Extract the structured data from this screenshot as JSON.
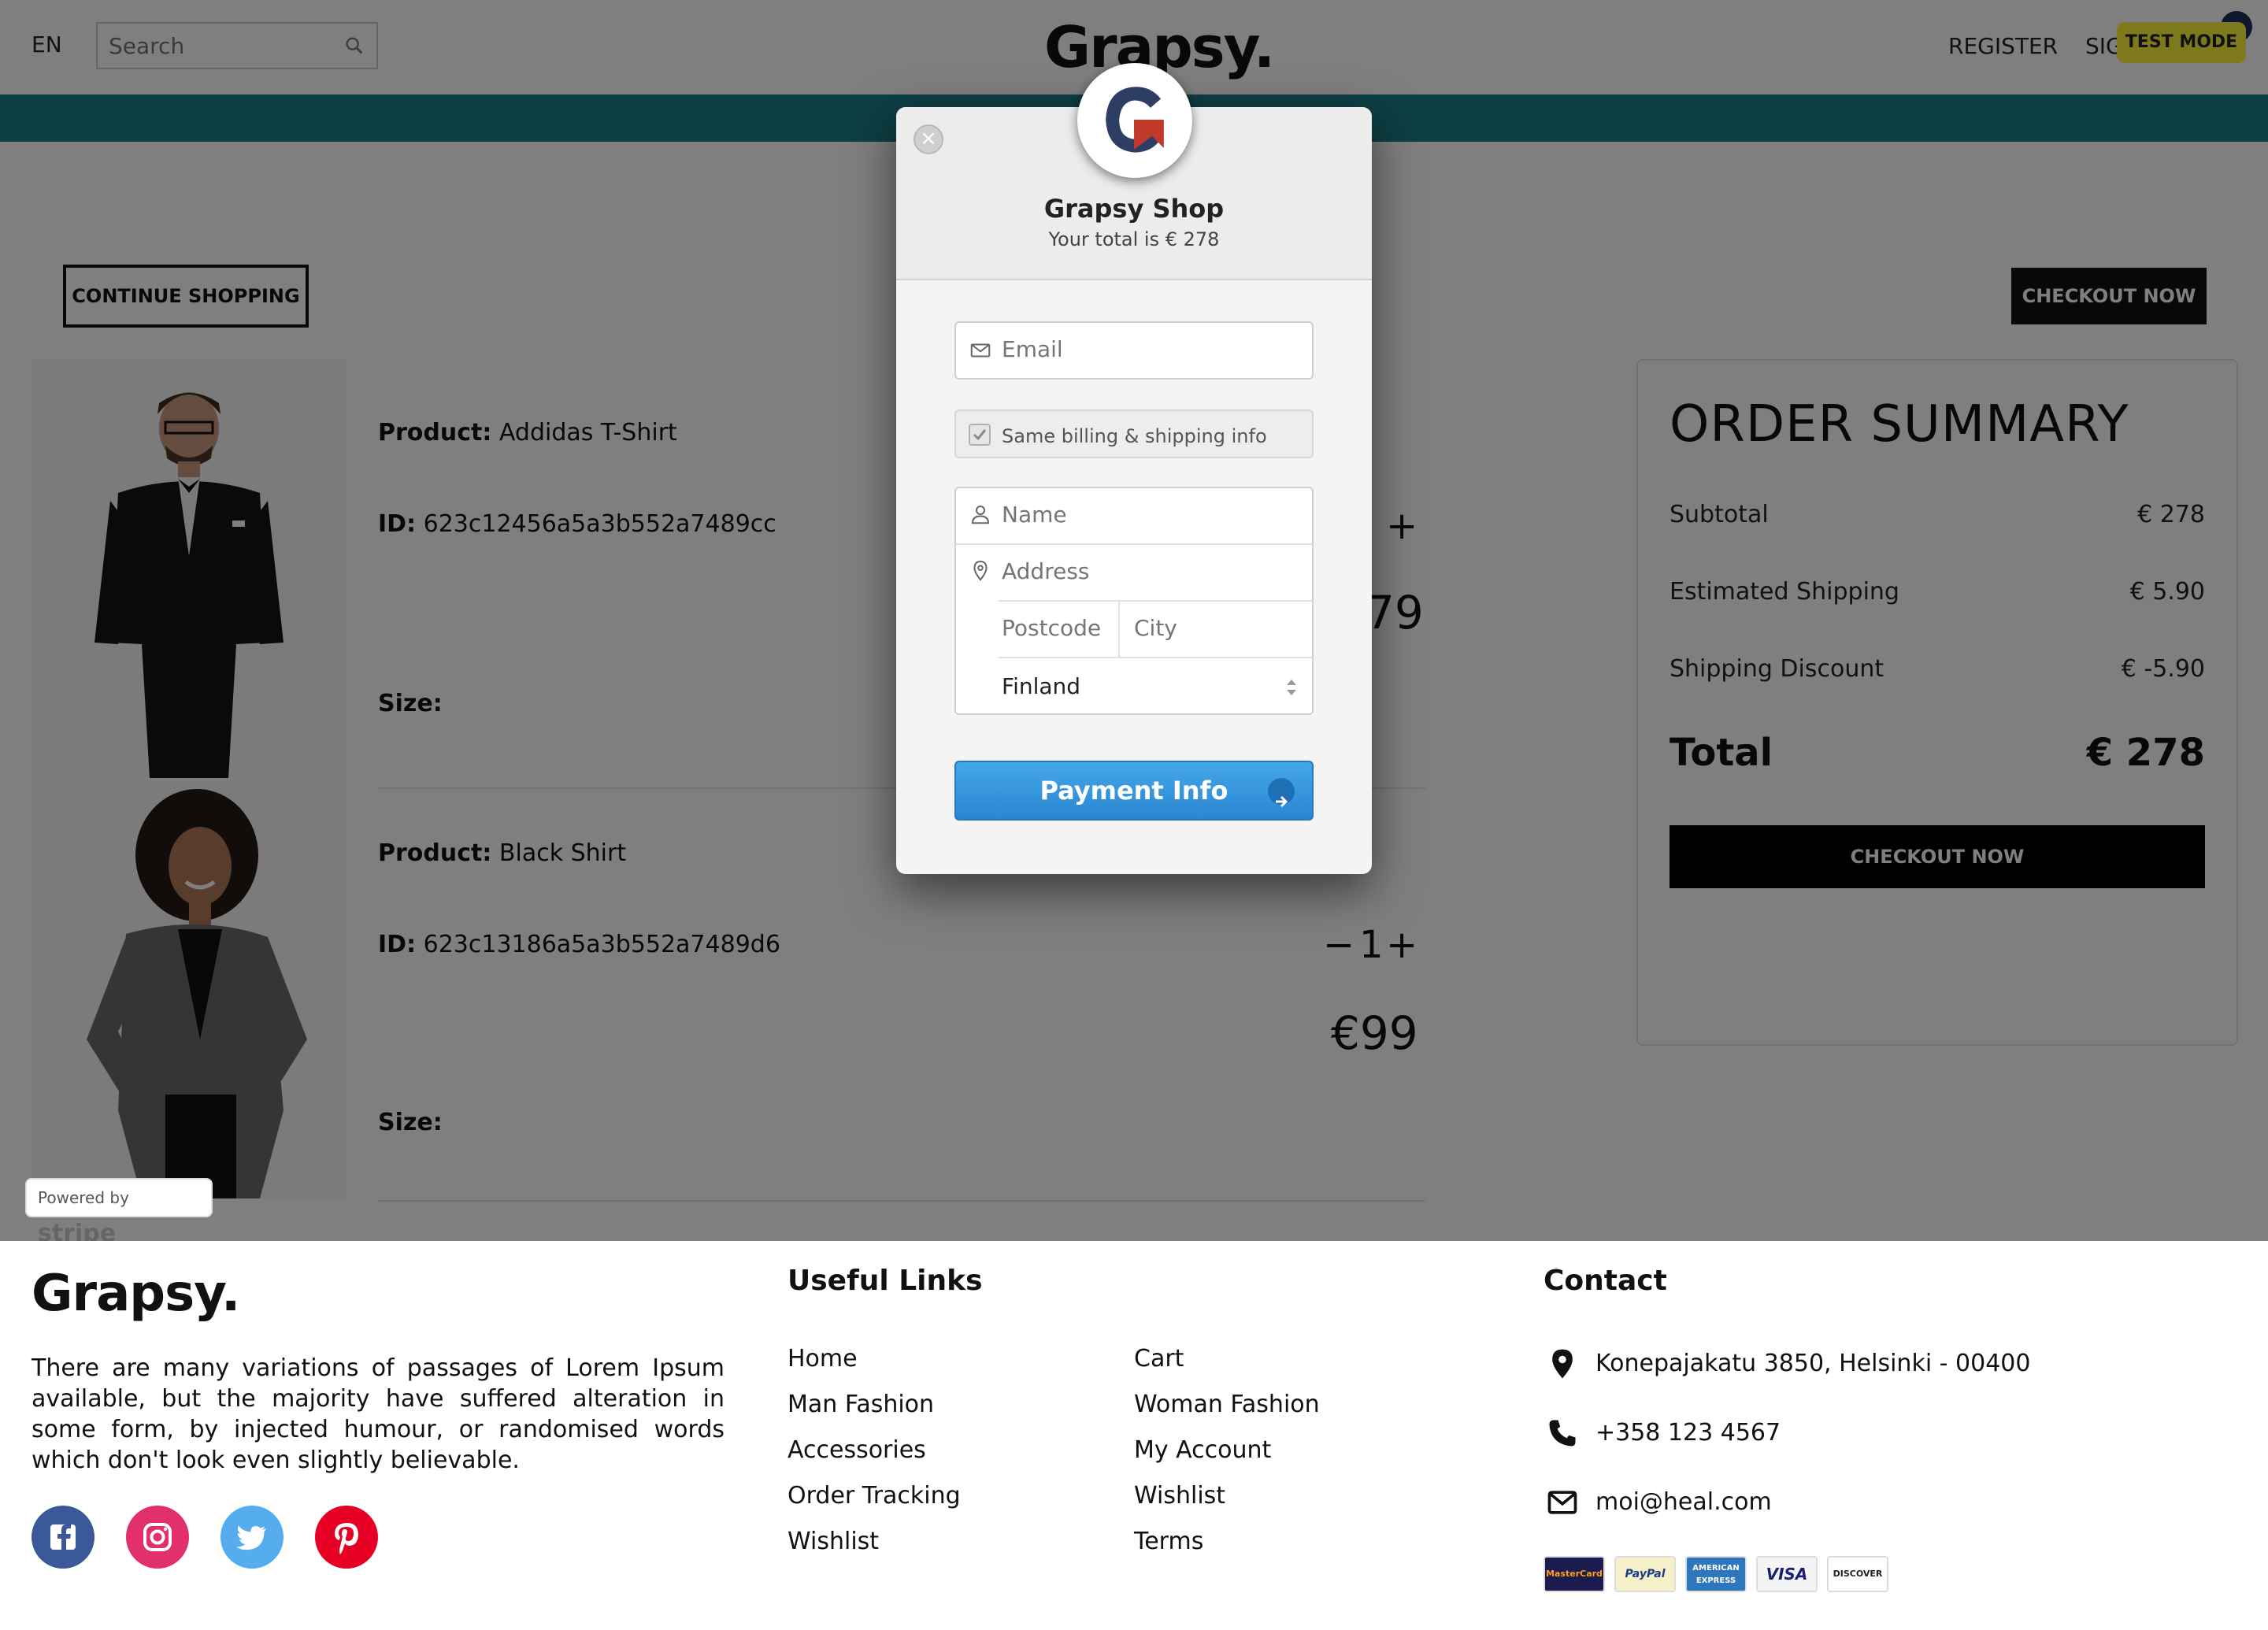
{
  "header": {
    "lang": "EN",
    "search_placeholder": "Search",
    "logo": "Grapsy.",
    "register": "REGISTER",
    "signin": "SIGN IN",
    "test_mode": "TEST MODE"
  },
  "main": {
    "continue_label": "CONTINUE SHOPPING",
    "checkout_label": "CHECKOUT NOW",
    "products": [
      {
        "product_label": "Product:",
        "name": "Addidas T-Shirt",
        "id_label": "ID:",
        "id": "623c12456a5a3b552a7489cc",
        "size_label": "Size:",
        "qty_plus": "+",
        "price": "79"
      },
      {
        "product_label": "Product:",
        "name": "Black Shirt",
        "id_label": "ID:",
        "id": "623c13186a5a3b552a7489d6",
        "size_label": "Size:",
        "qty_minus": "−",
        "qty": "1",
        "qty_plus": "+",
        "price": "€99"
      }
    ],
    "stripe_badge": {
      "powered": "Powered by",
      "brand": "stripe"
    }
  },
  "summary": {
    "title": "ORDER SUMMARY",
    "rows": [
      {
        "label": "Subtotal",
        "value": "€ 278"
      },
      {
        "label": "Estimated Shipping",
        "value": "€ 5.90"
      },
      {
        "label": "Shipping Discount",
        "value": "€ -5.90"
      }
    ],
    "total_label": "Total",
    "total_value": "€ 278",
    "checkout_label": "CHECKOUT NOW"
  },
  "modal": {
    "close": "×",
    "title": "Grapsy Shop",
    "subtitle": "Your total is € 278",
    "email_placeholder": "Email",
    "same_billing": "Same billing & shipping info",
    "name_placeholder": "Name",
    "address_placeholder": "Address",
    "postcode_placeholder": "Postcode",
    "city_placeholder": "City",
    "country": "Finland",
    "pay_button": "Payment Info"
  },
  "footer": {
    "logo": "Grapsy.",
    "description": "There are many variations of passages of Lorem Ipsum available, but the majority have suffered alteration in some form, by injected humour, or randomised words which don't look even slightly believable.",
    "social": [
      "facebook-icon",
      "instagram-icon",
      "twitter-icon",
      "pinterest-icon"
    ],
    "useful_title": "Useful Links",
    "links_col1": [
      "Home",
      "Man Fashion",
      "Accessories",
      "Order Tracking",
      "Wishlist"
    ],
    "links_col2": [
      "Cart",
      "Woman Fashion",
      "My Account",
      "Wishlist",
      "Terms"
    ],
    "contact_title": "Contact",
    "address": "Konepajakatu 3850, Helsinki - 00400",
    "phone": "+358 123 4567",
    "email": "moi@heal.com",
    "payment_cards": [
      "MasterCard",
      "PayPal",
      "AMERICAN EXPRESS",
      "VISA",
      "DISCOVER"
    ]
  },
  "colors": {
    "teal_bar": "#1c7f86",
    "test_mode": "#fff33b",
    "pay_button": "#3a9ae0",
    "facebook": "#3b5998",
    "instagram": "#e1306c",
    "twitter": "#55acee",
    "pinterest": "#e60023"
  }
}
